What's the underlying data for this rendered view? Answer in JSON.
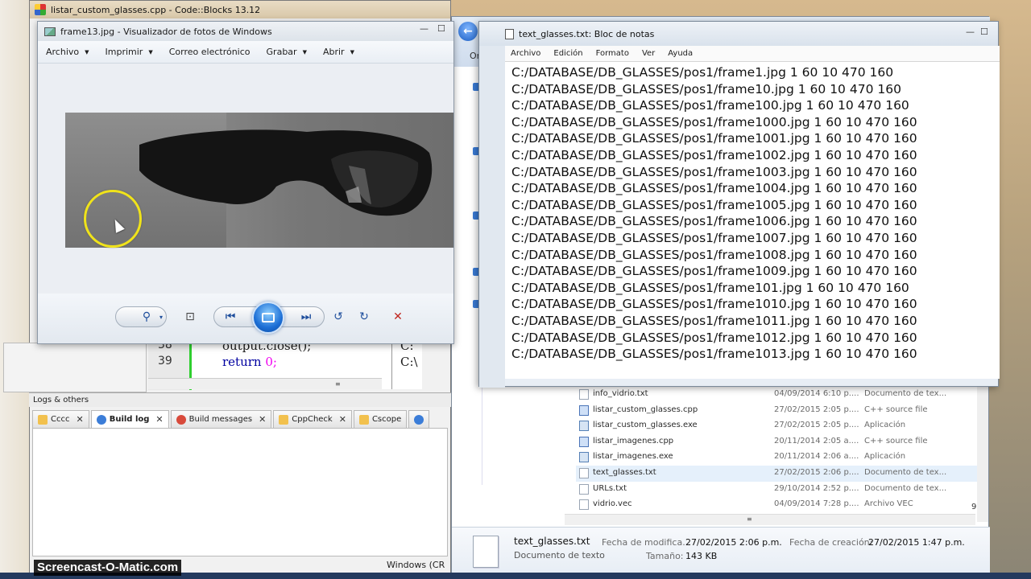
{
  "codeblocks": {
    "title": "listar_custom_glasses.cpp - Code::Blocks 13.12",
    "editor_lines": [
      {
        "num": "38",
        "code": "output.close();",
        "kw": "",
        "val": ""
      },
      {
        "num": "39",
        "code": "",
        "kw": "return",
        "val": "0;"
      }
    ],
    "right_frag": [
      "C:",
      "C:\\"
    ],
    "logs_header": "Logs & others",
    "log_tabs": [
      {
        "label": "Cccc",
        "color": "#f2c14e"
      },
      {
        "label": "Build log",
        "color": "#3b7dd8"
      },
      {
        "label": "Build messages",
        "color": "#d84a3b"
      },
      {
        "label": "CppCheck",
        "color": "#f2c14e"
      },
      {
        "label": "Cscope",
        "color": "#f2c14e"
      }
    ],
    "status_fragment": "Windows (CR"
  },
  "photo_viewer": {
    "title": "frame13.jpg - Visualizador de fotos de Windows",
    "menu": [
      {
        "label": "Archivo",
        "caret": true
      },
      {
        "label": "Imprimir",
        "caret": true
      },
      {
        "label": "Correo electrónico",
        "caret": false
      },
      {
        "label": "Grabar",
        "caret": true
      },
      {
        "label": "Abrir",
        "caret": true
      }
    ],
    "toolbar": {
      "zoom": "⚲",
      "zoom_caret": "▾",
      "actual": "⊡",
      "prev": "⏮",
      "next": "⏭",
      "rotate_ccw": "↺",
      "rotate_cw": "↻",
      "delete": "✕"
    }
  },
  "explorer": {
    "back": "←",
    "organize_fragment": "Or",
    "sidebar_fragments": [
      "o",
      "b",
      "m",
      "-|",
      "/",
      "/",
      "a",
      "7",
      "o",
      "v",
      "/",
      "o"
    ],
    "files": [
      {
        "name": "info_vidrio.txt",
        "date": "04/09/2014 6:10 p....",
        "type": "Documento de tex...",
        "icon": "txt",
        "selected": false
      },
      {
        "name": "listar_custom_glasses.cpp",
        "date": "27/02/2015 2:05 p....",
        "type": "C++ source file",
        "icon": "cpp",
        "selected": false
      },
      {
        "name": "listar_custom_glasses.exe",
        "date": "27/02/2015 2:05 p....",
        "type": "Aplicación",
        "icon": "exe",
        "selected": false
      },
      {
        "name": "listar_imagenes.cpp",
        "date": "20/11/2014 2:05 a....",
        "type": "C++ source file",
        "icon": "cpp",
        "selected": false
      },
      {
        "name": "listar_imagenes.exe",
        "date": "20/11/2014 2:06 a....",
        "type": "Aplicación",
        "icon": "exe",
        "selected": false
      },
      {
        "name": "text_glasses.txt",
        "date": "27/02/2015 2:06 p....",
        "type": "Documento de tex...",
        "icon": "txt",
        "selected": true
      },
      {
        "name": "URLs.txt",
        "date": "29/10/2014 2:52 p....",
        "type": "Documento de tex...",
        "icon": "txt",
        "selected": false
      },
      {
        "name": "vidrio.vec",
        "date": "04/09/2014 7:28 p....",
        "type": "Archivo VEC",
        "icon": "txt",
        "selected": false
      }
    ],
    "count_fragment": "9",
    "details": {
      "name": "text_glasses.txt",
      "type": "Documento de texto",
      "modified_label": "Fecha de modifica...",
      "modified_value": "27/02/2015 2:06 p.m.",
      "created_label": "Fecha de creación:",
      "created_value": "27/02/2015 1:47 p.m.",
      "size_label": "Tamaño:",
      "size_value": "143 KB"
    }
  },
  "notepad": {
    "title": "text_glasses.txt: Bloc de notas",
    "menu": [
      "Archivo",
      "Edición",
      "Formato",
      "Ver",
      "Ayuda"
    ],
    "lines": [
      "C:/DATABASE/DB_GLASSES/pos1/frame1.jpg 1 60 10 470 160",
      "C:/DATABASE/DB_GLASSES/pos1/frame10.jpg 1 60 10 470 160",
      "C:/DATABASE/DB_GLASSES/pos1/frame100.jpg 1 60 10 470 160",
      "C:/DATABASE/DB_GLASSES/pos1/frame1000.jpg 1 60 10 470 160",
      "C:/DATABASE/DB_GLASSES/pos1/frame1001.jpg 1 60 10 470 160",
      "C:/DATABASE/DB_GLASSES/pos1/frame1002.jpg 1 60 10 470 160",
      "C:/DATABASE/DB_GLASSES/pos1/frame1003.jpg 1 60 10 470 160",
      "C:/DATABASE/DB_GLASSES/pos1/frame1004.jpg 1 60 10 470 160",
      "C:/DATABASE/DB_GLASSES/pos1/frame1005.jpg 1 60 10 470 160",
      "C:/DATABASE/DB_GLASSES/pos1/frame1006.jpg 1 60 10 470 160",
      "C:/DATABASE/DB_GLASSES/pos1/frame1007.jpg 1 60 10 470 160",
      "C:/DATABASE/DB_GLASSES/pos1/frame1008.jpg 1 60 10 470 160",
      "C:/DATABASE/DB_GLASSES/pos1/frame1009.jpg 1 60 10 470 160",
      "C:/DATABASE/DB_GLASSES/pos1/frame101.jpg 1 60 10 470 160",
      "C:/DATABASE/DB_GLASSES/pos1/frame1010.jpg 1 60 10 470 160",
      "C:/DATABASE/DB_GLASSES/pos1/frame1011.jpg 1 60 10 470 160",
      "C:/DATABASE/DB_GLASSES/pos1/frame1012.jpg 1 60 10 470 160",
      "C:/DATABASE/DB_GLASSES/pos1/frame1013.jpg 1 60 10 470 160"
    ]
  },
  "window_controls": {
    "minimize": "—",
    "maximize": "☐",
    "close": "✕"
  },
  "watermark": "Screencast-O-Matic.com"
}
